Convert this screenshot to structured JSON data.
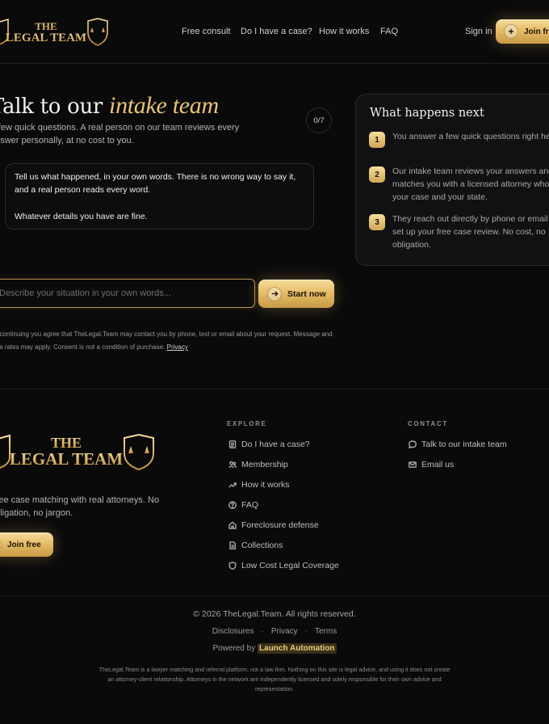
{
  "header": {
    "logo_top": "THE",
    "logo_bottom": "LEGAL TEAM",
    "nav": [
      "Free consult",
      "Do I have a case?",
      "How it works",
      "FAQ"
    ],
    "signin_label": "Sign in",
    "join_label": "Join free"
  },
  "hero": {
    "title_main": "Talk to our ",
    "title_accent": "intake team",
    "subtitle": "A few quick questions. A real person on our team reviews every answer personally, at no cost to you.",
    "progress_counter": "0/7",
    "message_line1": "Tell us what happened, in your own words. There is no wrong way to say it, and a real person reads every word.",
    "message_line2": "Whatever details you have are fine.",
    "input_placeholder": "Describe your situation in your own words...",
    "start_label": "Start now",
    "consent_text": "By continuing you agree that TheLegal.Team may contact you by phone, text or email about your request. Message and data rates may apply. Consent is not a condition of purchase.",
    "privacy_link": "Privacy"
  },
  "side_card": {
    "title": "What happens next",
    "steps": [
      {
        "num": "1",
        "text": "You answer a few quick questions right here."
      },
      {
        "num": "2",
        "text": "Our intake team reviews your answers and matches you with a licensed attorney who fits your case and your state."
      },
      {
        "num": "3",
        "text": "They reach out directly by phone or email to set up your free case review. No cost, no obligation."
      }
    ]
  },
  "footer": {
    "logo_top": "THE",
    "logo_bottom": "LEGAL TEAM",
    "tagline": "Free case matching with real attorneys. No obligation, no jargon.",
    "join_label": "Join free",
    "explore_heading": "EXPLORE",
    "explore_links": [
      {
        "label": "Do I have a case?",
        "icon": "document-icon"
      },
      {
        "label": "Membership",
        "icon": "users-icon"
      },
      {
        "label": "How it works",
        "icon": "trending-up-icon"
      },
      {
        "label": "FAQ",
        "icon": "help-circle-icon"
      },
      {
        "label": "Foreclosure defense",
        "icon": "home-icon"
      },
      {
        "label": "Collections",
        "icon": "file-text-icon"
      },
      {
        "label": "Low Cost Legal Coverage",
        "icon": "shield-icon"
      }
    ],
    "contact_heading": "CONTACT",
    "contact_links": [
      {
        "label": "Talk to our intake team",
        "icon": "chat-icon"
      },
      {
        "label": "Email us",
        "icon": "mail-icon"
      }
    ],
    "copyright": "© 2026 TheLegal.Team. All rights reserved.",
    "legal_links": [
      "Disclosures",
      "Privacy",
      "Terms"
    ],
    "powered_prefix": "Powered by",
    "powered_brand": "Launch Automation",
    "disclaimer": "TheLegal.Team is a lawyer matching and referral platform, not a law firm. Nothing on this site is legal advice, and using it does not create an attorney-client relationship. Attorneys in the network are independently licensed and solely responsible for their own advice and representation."
  }
}
